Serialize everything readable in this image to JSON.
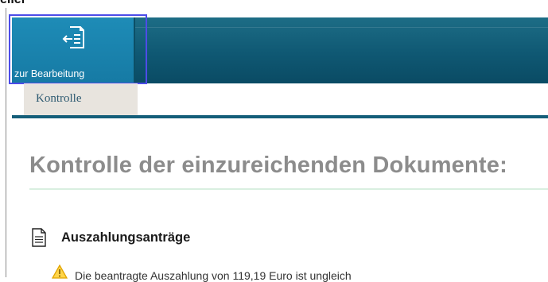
{
  "top_fragment": "eller",
  "back_button": {
    "label": "zur Bearbeitung",
    "icon": "exit-document-icon"
  },
  "tabs": [
    {
      "label": "Kontrolle",
      "active": true
    }
  ],
  "page": {
    "title": "Kontrolle der einzureichenden Dokumente:",
    "section": {
      "title": "Auszahlungsanträge",
      "icon": "document-icon",
      "warning": {
        "icon": "warning-icon",
        "text": "Die beantragte Auszahlung von 119,19 Euro ist ungleich"
      }
    }
  },
  "colors": {
    "header": "#0f5873",
    "back_button": "#167aa4",
    "focus_ring": "#4d4ce8",
    "tab_bg": "#e8e4de",
    "title": "#8c8c8c",
    "warning": "#f2b800"
  }
}
